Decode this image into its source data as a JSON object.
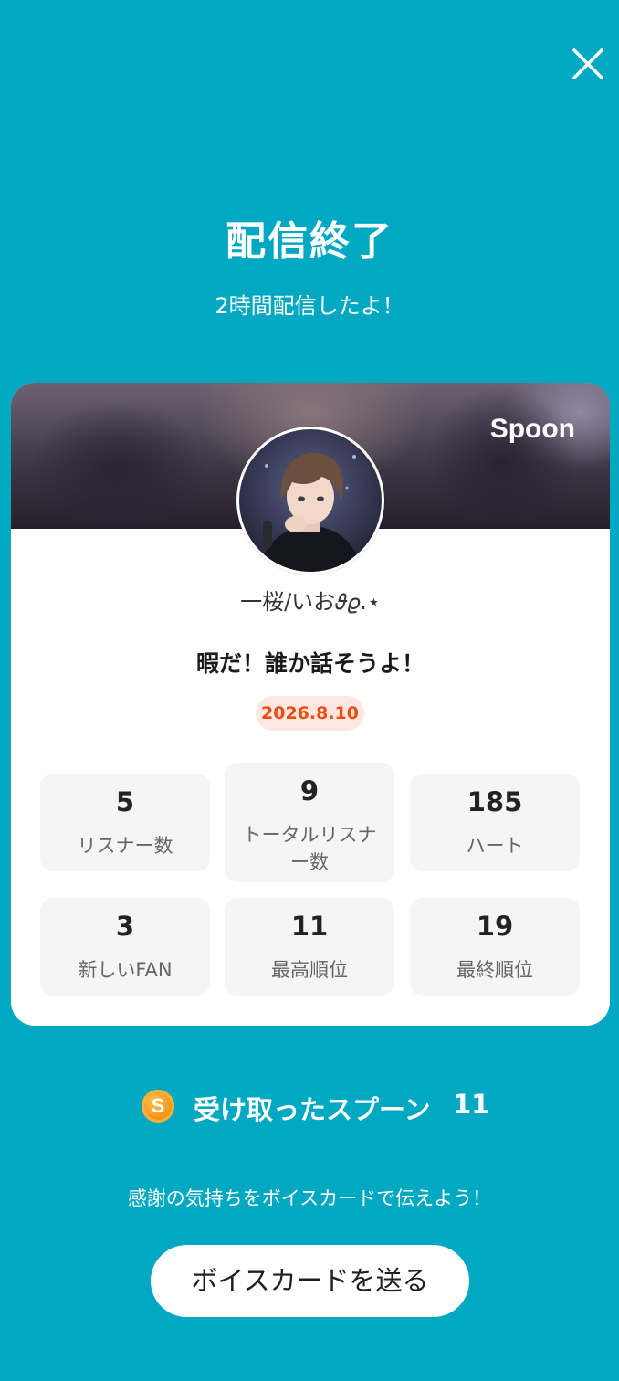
{
  "header": {
    "close_icon": "close-icon",
    "title": "配信終了",
    "subtitle": "2時間配信したよ！"
  },
  "card": {
    "brand": "Spoon",
    "username": "一桜/いお𝜗𝜚.⋆",
    "live_title": "暇だ！誰か話そうよ！",
    "date": "2026.8.10",
    "stats": [
      {
        "value": "5",
        "label": "リスナー数"
      },
      {
        "value": "9",
        "label_line1": "トータルリスナ",
        "label_line2": "ー数"
      },
      {
        "value": "185",
        "label": "ハート"
      },
      {
        "value": "3",
        "label": "新しいFAN"
      },
      {
        "value": "11",
        "label": "最高順位"
      },
      {
        "value": "19",
        "label": "最終順位"
      }
    ]
  },
  "spoons": {
    "coin_letter": "S",
    "label": "受け取ったスプーン",
    "count": "11"
  },
  "footer": {
    "message": "感謝の気持ちをボイスカードで伝えよう！",
    "button_label": "ボイスカードを送る"
  },
  "colors": {
    "background": "#00a8c1",
    "date_badge_bg": "#fde8e1",
    "date_badge_text": "#ef4c14",
    "coin": "#f2961c"
  }
}
